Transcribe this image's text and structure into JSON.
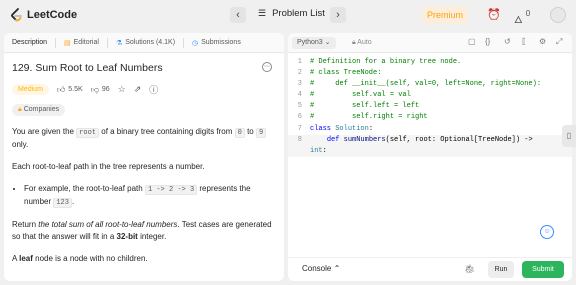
{
  "colors": {
    "accent": "#ffa116",
    "submit": "#2db55d",
    "medium": "#ffb800"
  },
  "topbar": {
    "logo_text": "LeetCode",
    "prev_icon": "chevron-left-icon",
    "next_icon": "chevron-right-icon",
    "problem_list_label": "Problem List",
    "premium_label": "Premium",
    "fire_count": "0"
  },
  "left_tabs": [
    {
      "label": "Description",
      "icon": ""
    },
    {
      "label": "Editorial",
      "icon": "book-icon"
    },
    {
      "label": "Solutions (4.1K)",
      "icon": "flask-icon"
    },
    {
      "label": "Submissions",
      "icon": "clock-icon"
    }
  ],
  "problem": {
    "title": "129. Sum Root to Leaf Numbers",
    "difficulty": "Medium",
    "likes": "5.5K",
    "dislikes": "96",
    "companies_label": "Companies",
    "p1_a": "You are given the ",
    "p1_code1": "root",
    "p1_b": " of a binary tree containing digits from ",
    "p1_code2": "0",
    "p1_c": " to ",
    "p1_code3": "9",
    "p1_d": " only.",
    "p2": "Each root-to-leaf path in the tree represents a number.",
    "bullet_a": "For example, the root-to-leaf path ",
    "bullet_code1": "1 -> 2 -> 3",
    "bullet_b": " represents the number ",
    "bullet_code2": "123",
    "bullet_c": ".",
    "p3_a": "Return ",
    "p3_b": "the total sum of all root-to-leaf numbers",
    "p3_c": ". Test cases are generated so that the answer will fit in a ",
    "p3_d": "32-bit",
    "p3_e": " integer.",
    "p4_a": "A ",
    "p4_b": "leaf",
    "p4_c": " node is a node with no children."
  },
  "editor": {
    "language": "Python3",
    "mode": "Auto",
    "lines": [
      {
        "n": "1",
        "segs": [
          {
            "c": "c-comment",
            "t": "# Definition for a binary tree node."
          }
        ]
      },
      {
        "n": "2",
        "segs": [
          {
            "c": "c-comment",
            "t": "# class TreeNode:"
          }
        ]
      },
      {
        "n": "3",
        "segs": [
          {
            "c": "c-comment",
            "t": "#     def __init__(self, val=0, left=None, right=None):"
          }
        ]
      },
      {
        "n": "4",
        "segs": [
          {
            "c": "c-comment",
            "t": "#         self.val = val"
          }
        ]
      },
      {
        "n": "5",
        "segs": [
          {
            "c": "c-comment",
            "t": "#         self.left = left"
          }
        ]
      },
      {
        "n": "6",
        "segs": [
          {
            "c": "c-comment",
            "t": "#         self.right = right"
          }
        ]
      },
      {
        "n": "7",
        "segs": [
          {
            "c": "c-kw",
            "t": "class "
          },
          {
            "c": "c-name",
            "t": "Solution"
          },
          {
            "c": "c-plain",
            "t": ":"
          }
        ]
      },
      {
        "n": "8",
        "segs": [
          {
            "c": "c-plain",
            "t": "    "
          },
          {
            "c": "c-kw",
            "t": "def "
          },
          {
            "c": "c-text",
            "t": "sumNumbers"
          },
          {
            "c": "c-plain",
            "t": "(self, root: Optional[TreeNode]) ->"
          }
        ]
      },
      {
        "n": "",
        "segs": [
          {
            "c": "c-name",
            "t": "int"
          },
          {
            "c": "c-plain",
            "t": ":"
          }
        ]
      }
    ]
  },
  "bottom": {
    "console_label": "Console",
    "run_label": "Run",
    "submit_label": "Submit"
  }
}
